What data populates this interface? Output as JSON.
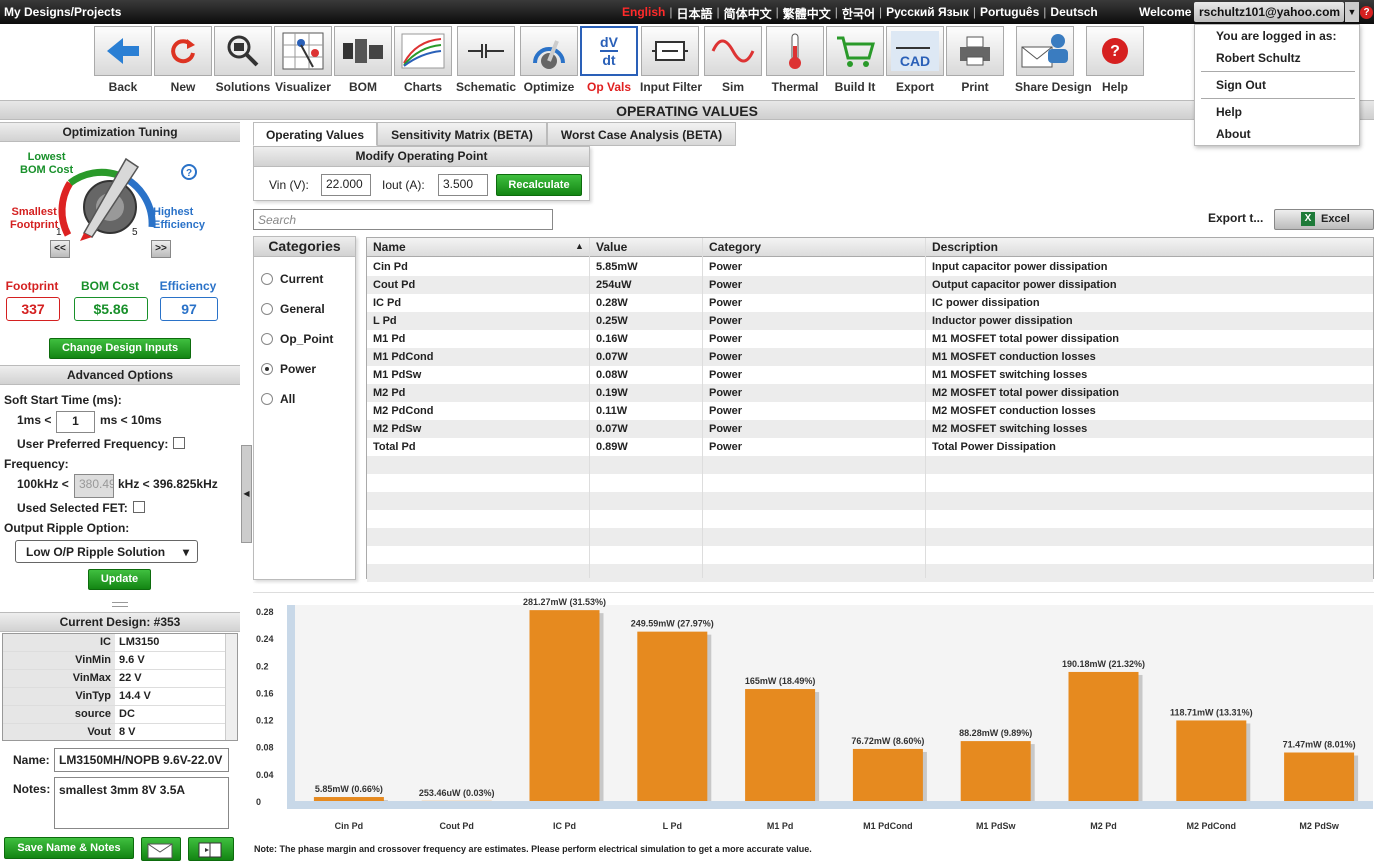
{
  "topbar": {
    "brand": "My Designs/Projects",
    "languages": [
      "English",
      "日本語",
      "简体中文",
      "繁體中文",
      "한국어",
      "Русский Язык",
      "Português",
      "Deutsch"
    ],
    "welcome": "Welcome",
    "user_email": "rschultz101@yahoo.com"
  },
  "user_menu": {
    "logged_in_as": "You are logged in as:",
    "name": "Robert Schultz",
    "sign_out": "Sign Out",
    "help": "Help",
    "about": "About"
  },
  "toolbar": [
    {
      "label": "Back",
      "icon": "back-arrow-icon"
    },
    {
      "label": "New",
      "icon": "refresh-icon"
    },
    {
      "label": "Solutions",
      "icon": "magnifier-chip-icon"
    },
    {
      "label": "Visualizer",
      "icon": "visualizer-grid-icon"
    },
    {
      "label": "BOM",
      "icon": "bom-components-icon"
    },
    {
      "label": "Charts",
      "icon": "charts-icon"
    },
    {
      "label": "Schematic",
      "icon": "schematic-icon"
    },
    {
      "label": "Optimize",
      "icon": "optimize-dial-icon"
    },
    {
      "label": "Op Vals",
      "icon": "dvdt-icon",
      "active": true
    },
    {
      "label": "Input Filter",
      "icon": "input-filter-icon"
    },
    {
      "label": "Sim",
      "icon": "sine-wave-icon"
    },
    {
      "label": "Thermal",
      "icon": "thermometer-icon"
    },
    {
      "label": "Build It",
      "icon": "shopping-cart-icon"
    },
    {
      "label": "Export",
      "icon": "cad-export-icon"
    },
    {
      "label": "Print",
      "icon": "printer-icon"
    },
    {
      "label": "Share Design",
      "icon": "share-envelope-icon"
    },
    {
      "label": "Help",
      "icon": "help-icon"
    }
  ],
  "page_title": "OPERATING VALUES",
  "left": {
    "opt_title": "Optimization Tuning",
    "dial": {
      "lowest": "Lowest",
      "bom_cost": "BOM Cost",
      "smallest": "Smallest",
      "footprint": "Footprint",
      "highest": "Highest",
      "efficiency": "Efficiency",
      "tick1": "1",
      "tick5": "5"
    },
    "prev_btn": "<<",
    "next_btn": ">>",
    "metrics": [
      {
        "label": "Footprint",
        "value": "337",
        "color": "#d42020"
      },
      {
        "label": "BOM Cost",
        "value": "$5.86",
        "color": "#18902a"
      },
      {
        "label": "Efficiency",
        "value": "97",
        "color": "#2a72c8"
      }
    ],
    "change_inputs": "Change Design Inputs",
    "adv_title": "Advanced Options",
    "soft_start_label": "Soft Start Time (ms):",
    "soft_start_min": "1ms <",
    "soft_start_value": "1",
    "soft_start_max": "ms < 10ms",
    "user_freq_label": "User Preferred Frequency:",
    "freq_label": "Frequency:",
    "freq_min": "100kHz <",
    "freq_value": "380.49",
    "freq_max": "kHz < 396.825kHz",
    "used_fet_label": "Used Selected FET:",
    "ripple_label": "Output Ripple Option:",
    "ripple_value": "Low O/P Ripple Solution",
    "update": "Update",
    "current_design": "Current Design: #353",
    "design_rows": [
      {
        "k": "IC",
        "v": "LM3150"
      },
      {
        "k": "VinMin",
        "v": "9.6 V"
      },
      {
        "k": "VinMax",
        "v": "22 V"
      },
      {
        "k": "VinTyp",
        "v": "14.4 V"
      },
      {
        "k": "source",
        "v": "DC"
      },
      {
        "k": "Vout",
        "v": "8 V"
      }
    ],
    "name_label": "Name:",
    "name_value": "LM3150MH/NOPB 9.6V-22.0V",
    "notes_label": "Notes:",
    "notes_value": "smallest 3mm 8V 3.5A",
    "save": "Save Name & Notes"
  },
  "tabs": [
    "Operating Values",
    "Sensitivity Matrix (BETA)",
    "Worst Case Analysis (BETA)"
  ],
  "op_point": {
    "title": "Modify Operating Point",
    "vin_label": "Vin (V):",
    "vin": "22.000",
    "iout_label": "Iout (A):",
    "iout": "3.500",
    "recalc": "Recalculate"
  },
  "search_placeholder": "Search",
  "export_label": "Export t...",
  "excel": "Excel",
  "categories": {
    "title": "Categories",
    "items": [
      "Current",
      "General",
      "Op_Point",
      "Power",
      "All"
    ],
    "selected": "Power"
  },
  "table": {
    "headers": [
      "Name",
      "Value",
      "Category",
      "Description"
    ],
    "rows": [
      [
        "Cin Pd",
        "5.85mW",
        "Power",
        "Input capacitor power dissipation"
      ],
      [
        "Cout Pd",
        "254uW",
        "Power",
        "Output capacitor power dissipation"
      ],
      [
        "IC Pd",
        "0.28W",
        "Power",
        "IC power dissipation"
      ],
      [
        "L Pd",
        "0.25W",
        "Power",
        "Inductor power dissipation"
      ],
      [
        "M1 Pd",
        "0.16W",
        "Power",
        "M1 MOSFET total power dissipation"
      ],
      [
        "M1 PdCond",
        "0.07W",
        "Power",
        "M1 MOSFET conduction losses"
      ],
      [
        "M1 PdSw",
        "0.08W",
        "Power",
        "M1 MOSFET switching losses"
      ],
      [
        "M2 Pd",
        "0.19W",
        "Power",
        "M2 MOSFET total power dissipation"
      ],
      [
        "M2 PdCond",
        "0.11W",
        "Power",
        "M2 MOSFET conduction losses"
      ],
      [
        "M2 PdSw",
        "0.07W",
        "Power",
        "M2 MOSFET switching losses"
      ],
      [
        "Total Pd",
        "0.89W",
        "Power",
        "Total Power Dissipation"
      ]
    ]
  },
  "chart_data": {
    "type": "bar",
    "categories": [
      "Cin Pd",
      "Cout Pd",
      "IC Pd",
      "L Pd",
      "M1 Pd",
      "M1 PdCond",
      "M1 PdSw",
      "M2 Pd",
      "M2 PdCond",
      "M2 PdSw"
    ],
    "values": [
      0.00585,
      0.00025346,
      0.28127,
      0.24959,
      0.165,
      0.07672,
      0.08828,
      0.19018,
      0.11871,
      0.07147
    ],
    "labels": [
      "5.85mW (0.66%)",
      "253.46uW (0.03%)",
      "281.27mW (31.53%)",
      "249.59mW (27.97%)",
      "165mW (18.49%)",
      "76.72mW (8.60%)",
      "88.28mW (9.89%)",
      "190.18mW (21.32%)",
      "118.71mW (13.31%)",
      "71.47mW (8.01%)"
    ],
    "yticks": [
      "0",
      "0.04",
      "0.08",
      "0.12",
      "0.16",
      "0.2",
      "0.24",
      "0.28"
    ],
    "ylim": [
      0,
      0.28
    ],
    "bar_color": "#e68a1f",
    "grid": false
  },
  "note": "Note: The phase margin and crossover frequency are estimates.  Please perform electrical simulation to get a more accurate value."
}
